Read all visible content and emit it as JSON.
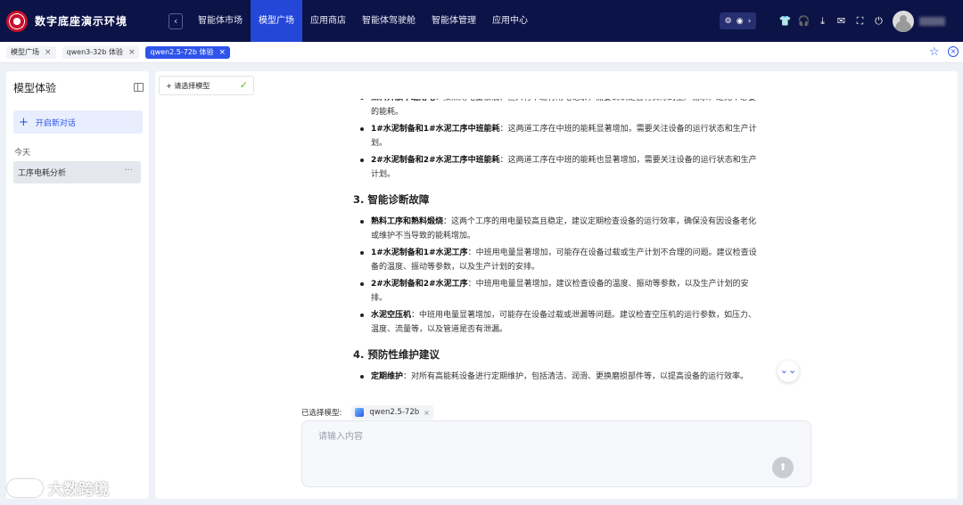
{
  "app": {
    "brand": "数字底座演示环境",
    "nav": [
      "智能体市场",
      "模型广场",
      "应用商店",
      "智能体驾驶舱",
      "智能体管理",
      "应用中心"
    ],
    "active_nav": "模型广场",
    "collapse_glyph": "‹",
    "pill_icons": [
      "⚙",
      "◉",
      "›"
    ],
    "top_icons": [
      {
        "name": "tshirt-icon",
        "glyph": "👕"
      },
      {
        "name": "headset-icon",
        "glyph": "🎧"
      },
      {
        "name": "download-icon",
        "glyph": "⤓"
      },
      {
        "name": "mail-icon",
        "glyph": "✉"
      },
      {
        "name": "fullscreen-icon",
        "glyph": "⛶"
      },
      {
        "name": "power-icon",
        "glyph": "⏻"
      }
    ]
  },
  "tabs": [
    {
      "label": "模型广场",
      "active": false
    },
    {
      "label": "qwen3-32b 体验",
      "active": false
    },
    {
      "label": "qwen2.5-72b 体验",
      "active": true
    }
  ],
  "tab_close_glyph": "×",
  "sidebar": {
    "title": "模型体验",
    "new_chat": "开启新对话",
    "new_chat_glyph": "+",
    "group": "今天",
    "history": [
      {
        "label": "工序电耗分析"
      }
    ],
    "more_glyph": "···"
  },
  "main": {
    "model_select": "+ 请选择模型",
    "check_glyph": "✓",
    "content": {
      "partial_items": [
        {
          "bold": "熟料开放中班用电",
          "text": "：虽然用电量很低，但只有中班有用电记录，需要确认是否有实际的生产需求，避免不必要的能耗。"
        },
        {
          "bold": "1#水泥制备和1#水泥工序中班能耗",
          "text": "：这两道工序在中班的能耗显著增加，需要关注设备的运行状态和生产计划。"
        },
        {
          "bold": "2#水泥制备和2#水泥工序中班能耗",
          "text": "：这两道工序在中班的能耗也显著增加，需要关注设备的运行状态和生产计划。"
        }
      ],
      "sections": [
        {
          "heading": "3. 智能诊断故障",
          "items": [
            {
              "bold": "熟料工序和熟料煅烧",
              "text": "：这两个工序的用电量较高且稳定，建议定期检查设备的运行效率，确保没有因设备老化或维护不当导致的能耗增加。"
            },
            {
              "bold": "1#水泥制备和1#水泥工序",
              "text": "：中班用电量显著增加，可能存在设备过载或生产计划不合理的问题。建议检查设备的温度、振动等参数，以及生产计划的安排。"
            },
            {
              "bold": "2#水泥制备和2#水泥工序",
              "text": "：中班用电量显著增加，建议检查设备的温度、振动等参数，以及生产计划的安排。"
            },
            {
              "bold": "水泥空压机",
              "text": "：中班用电量显著增加，可能存在设备过载或泄漏等问题。建议检查空压机的运行参数，如压力、温度、流量等，以及管道是否有泄漏。"
            }
          ]
        },
        {
          "heading": "4. 预防性维护建议",
          "items": [
            {
              "bold": "定期维护",
              "text": "：对所有高能耗设备进行定期维护，包括清洁、润滑、更换磨损部件等，以提高设备的运行效率。"
            }
          ]
        }
      ]
    },
    "scroll_glyph": "⌄⌄",
    "selected_label": "已选择模型:",
    "selected_model": "qwen2.5-72b",
    "chip_close_glyph": "×",
    "input_placeholder": "请输入内容",
    "send_glyph": "⬆"
  },
  "watermark": "大数跨境",
  "star_glyph": "☆",
  "close_all_glyph": "×",
  "colors": {
    "nav_bg": "#0c1347",
    "active": "#2447d8",
    "accent": "#2f54eb"
  }
}
